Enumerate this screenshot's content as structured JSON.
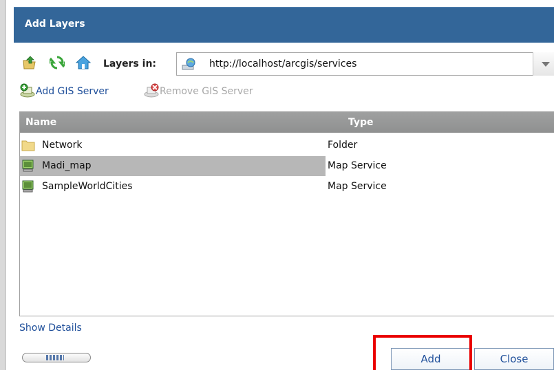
{
  "dialog": {
    "title": "Add Layers"
  },
  "toolbar": {
    "up_icon": "folder-up-icon",
    "refresh_icon": "refresh-icon",
    "home_icon": "home-icon",
    "layers_in_label": "Layers in:",
    "url_icon": "server-globe-icon",
    "url_value": "http://localhost/arcgis/services"
  },
  "server_actions": {
    "add_label": "Add GIS Server",
    "remove_label": "Remove GIS Server"
  },
  "grid": {
    "columns": [
      "Name",
      "Type"
    ],
    "rows": [
      {
        "icon": "folder-icon",
        "name": "Network",
        "type": "Folder",
        "selected": false
      },
      {
        "icon": "map-service-icon",
        "name": "Madi_map",
        "type": "Map Service",
        "selected": true
      },
      {
        "icon": "map-service-icon",
        "name": "SampleWorldCities",
        "type": "Map Service",
        "selected": false
      }
    ]
  },
  "footer": {
    "show_details": "Show Details",
    "add_button": "Add",
    "close_button": "Close"
  },
  "colors": {
    "title_bar": "#336699",
    "highlight": "#ea0000",
    "link": "#1f4f9a"
  }
}
